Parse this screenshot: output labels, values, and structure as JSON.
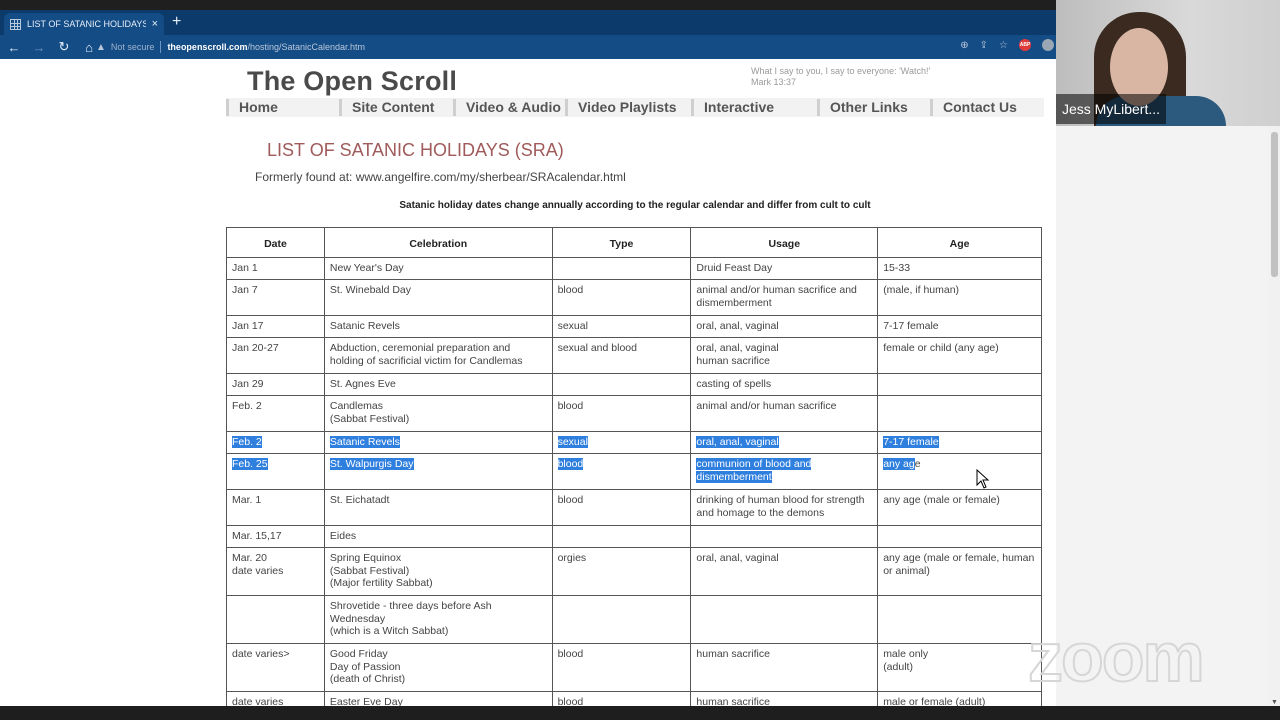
{
  "browser": {
    "tab_title": "LIST OF SATANIC HOLIDAYS (SRA",
    "tab_close": "×",
    "new_tab": "+",
    "security_label": "Not secure",
    "url_host": "theopenscroll.com",
    "url_path": "/hosting/SatanicCalendar.htm",
    "icons": {
      "back": "←",
      "forward": "→",
      "reload": "↻",
      "home": "⌂",
      "warning": "▲",
      "zoom": "⊕",
      "share": "⇪",
      "bookmark": "☆",
      "abp": "ABP"
    }
  },
  "site": {
    "title": "The Open Scroll",
    "quote_line1": "What I say to you, I say to everyone: 'Watch!'",
    "quote_line2": "Mark 13:37",
    "nav": [
      "Home",
      "Site Content",
      "Video & Audio",
      "Video Playlists",
      "Interactive",
      "Other Links",
      "Contact Us"
    ]
  },
  "content": {
    "heading": "LIST OF SATANIC HOLIDAYS (SRA)",
    "formerly": "Formerly found at: www.angelfire.com/my/sherbear/SRAcalendar.html",
    "note": "Satanic holiday dates change annually according to the regular calendar and differ from cult to cult"
  },
  "table": {
    "headers": [
      "Date",
      "Celebration",
      "Type",
      "Usage",
      "Age"
    ],
    "rows": [
      {
        "date": "Jan 1",
        "celebration": "New Year's Day",
        "type": "",
        "usage": "Druid Feast Day",
        "age": "15-33"
      },
      {
        "date": "Jan 7",
        "celebration": "St. Winebald Day",
        "type": "blood",
        "usage": "animal and/or human sacrifice and dismemberment",
        "age": "(male, if human)"
      },
      {
        "date": "Jan 17",
        "celebration": "Satanic Revels",
        "type": "sexual",
        "usage": "oral, anal, vaginal",
        "age": "7-17 female"
      },
      {
        "date": "Jan 20-27",
        "celebration": "Abduction, ceremonial preparation and holding of sacrificial victim for Candlemas",
        "type": "sexual and blood",
        "usage": "oral, anal, vaginal\nhuman sacrifice",
        "age": "female or child (any age)"
      },
      {
        "date": "Jan 29",
        "celebration": "St. Agnes Eve",
        "type": "",
        "usage": "casting of spells",
        "age": ""
      },
      {
        "date": "Feb. 2",
        "celebration": "Candlemas\n(Sabbat Festival)",
        "type": "blood",
        "usage": "animal and/or human sacrifice",
        "age": ""
      },
      {
        "date": "Feb. 2",
        "celebration": "Satanic Revels",
        "type": "sexual",
        "usage": "oral, anal, vaginal",
        "age": "7-17 female",
        "selected": true
      },
      {
        "date": "Feb. 25",
        "celebration": "St. Walpurgis Day",
        "type": "blood",
        "usage": "communion of blood and dismemberment",
        "age": "any age",
        "selected": true,
        "age_selected_part": "any ag",
        "age_unselected_part": "e"
      },
      {
        "date": "Mar. 1",
        "celebration": "St. Eichatadt",
        "type": "blood",
        "usage": "drinking of human blood for strength and homage to the demons",
        "age": "any age (male or female)"
      },
      {
        "date": "Mar. 15,17",
        "celebration": "Eides",
        "type": "",
        "usage": "",
        "age": ""
      },
      {
        "date": "Mar. 20\ndate varies",
        "celebration": "Spring Equinox\n(Sabbat Festival)\n(Major fertility Sabbat)",
        "type": "orgies",
        "usage": "oral, anal, vaginal",
        "age": "any age (male or female, human or animal)"
      },
      {
        "date": "",
        "celebration": "Shrovetide - three days before Ash Wednesday\n(which is a Witch Sabbat)",
        "type": "",
        "usage": "",
        "age": ""
      },
      {
        "date": "date varies>",
        "celebration": "Good Friday\nDay of Passion\n(death of Christ)",
        "type": "blood",
        "usage": "human sacrifice",
        "age": "male only\n(adult)"
      },
      {
        "date": "date varies",
        "celebration": "Easter Eve Day",
        "type": "blood",
        "usage": "human sacrifice",
        "age": "male or female (adult)"
      }
    ]
  },
  "zoom_call": {
    "participant_name": "Jess MyLibert...",
    "logo": "zoom"
  },
  "colors": {
    "tab_bar": "#0c3a6b",
    "toolbar": "#144c86",
    "selection": "#2f7fde",
    "heading": "#a05a5a"
  }
}
